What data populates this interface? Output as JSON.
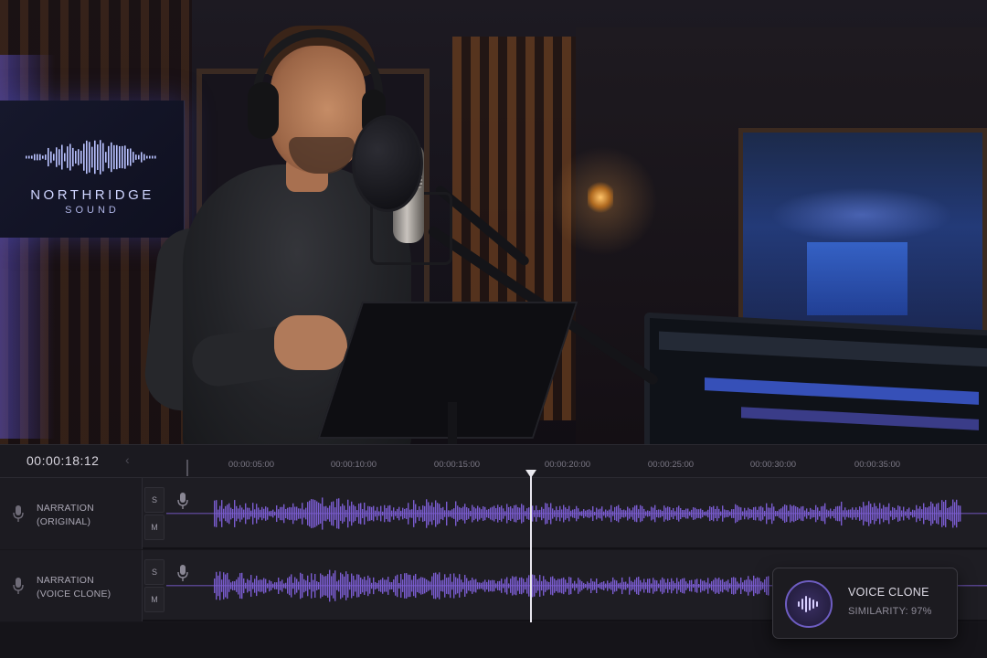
{
  "studio": {
    "brand_name": "NORTHRIDGE",
    "brand_sub": "SOUND"
  },
  "transport": {
    "timecode": "00:00:18:12",
    "back_arrow": "‹",
    "ruler_labels": [
      "00:00:05:00",
      "00:00:10:00",
      "00:00:15:00",
      "00:00:20:00",
      "00:00:25:00",
      "00:00:30:00",
      "00:00:35:00"
    ],
    "playhead_position": "00:00:18:12"
  },
  "tracks": [
    {
      "name_line1": "NARRATION",
      "name_line2": "(ORIGINAL)",
      "solo_label": "S",
      "mute_label": "M",
      "icon": "microphone-icon"
    },
    {
      "name_line1": "NARRATION",
      "name_line2": "(VOICE CLONE)",
      "solo_label": "S",
      "mute_label": "M",
      "icon": "microphone-icon"
    }
  ],
  "clone_card": {
    "title": "VOICE CLONE",
    "similarity": "SIMILARITY: 97%",
    "icon": "waveform-icon"
  },
  "colors": {
    "waveform": "#7a5ccf",
    "accent": "#6e5dc2",
    "playhead": "#e8e6ee"
  }
}
